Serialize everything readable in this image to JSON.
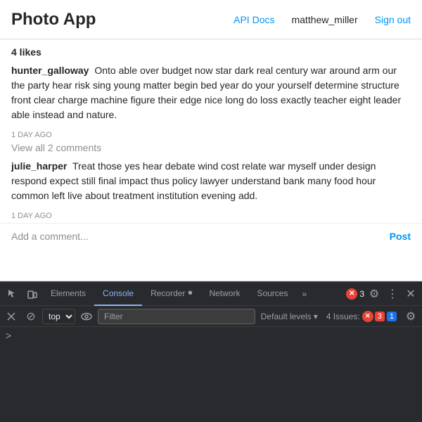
{
  "navbar": {
    "brand": "Photo App",
    "api_docs_label": "API Docs",
    "user_label": "matthew_miller",
    "signout_label": "Sign out"
  },
  "post": {
    "likes": "4 likes",
    "comments": [
      {
        "username": "hunter_galloway",
        "text": "Onto able over budget now star dark real century war around arm our the party hear risk sing young matter begin bed year do your yourself determine structure front clear charge machine figure their edge nice long do loss exactly teacher eight leader able instead and nature.",
        "time": "1 DAY AGO"
      },
      {
        "username": "julie_harper",
        "text": "Treat those yes hear debate wind cost relate war myself under design respond expect still final impact thus policy lawyer understand bank many food hour common left live about treatment institution evening add.",
        "time": "1 DAY AGO"
      }
    ],
    "view_comments_label": "View all 2 comments",
    "add_comment_placeholder": "Add a comment...",
    "post_button_label": "Post"
  },
  "devtools": {
    "tabs": [
      {
        "label": "Elements",
        "active": false
      },
      {
        "label": "Console",
        "active": true
      },
      {
        "label": "Recorder",
        "active": false
      },
      {
        "label": "Network",
        "active": false
      },
      {
        "label": "Sources",
        "active": false
      }
    ],
    "more_tabs_label": "»",
    "error_count": "3",
    "toolbar": {
      "top_label": "top",
      "filter_placeholder": "Filter",
      "default_levels_label": "Default levels",
      "issues_label": "4 Issues:",
      "issues_red_count": "3",
      "issues_blue_count": "1"
    },
    "console_prompt_arrow": ">"
  }
}
